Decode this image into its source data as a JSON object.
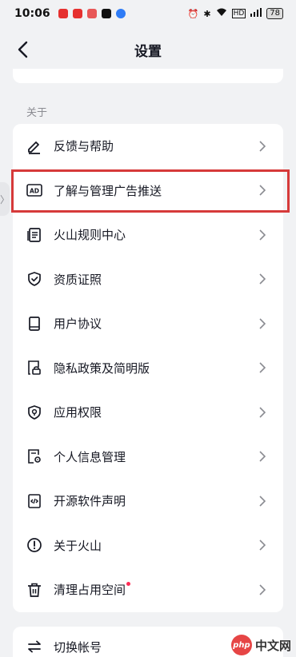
{
  "status": {
    "time": "10:06",
    "battery": "78",
    "app_icon_colors": [
      "#e6302f",
      "#e6302f",
      "#111111",
      "#111111",
      "#2f7cf6"
    ]
  },
  "header": {
    "title": "设置"
  },
  "about_section": {
    "label": "关于",
    "items": [
      {
        "label": "反馈与帮助",
        "icon": "pencil-icon"
      },
      {
        "label": "了解与管理广告推送",
        "icon": "ad-icon"
      },
      {
        "label": "火山规则中心",
        "icon": "rules-doc-icon"
      },
      {
        "label": "资质证照",
        "icon": "shield-check-icon"
      },
      {
        "label": "用户协议",
        "icon": "book-icon"
      },
      {
        "label": "隐私政策及简明版",
        "icon": "lock-doc-icon"
      },
      {
        "label": "应用权限",
        "icon": "shield-pin-icon"
      },
      {
        "label": "个人信息管理",
        "icon": "doc-gear-icon"
      },
      {
        "label": "开源软件声明",
        "icon": "code-doc-icon"
      },
      {
        "label": "关于火山",
        "icon": "info-circle-icon"
      },
      {
        "label": "清理占用空间",
        "icon": "trash-icon",
        "badge": true
      }
    ]
  },
  "account_section": {
    "items": [
      {
        "label": "切换帐号",
        "icon": "switch-icon"
      }
    ]
  },
  "watermark": {
    "logo_text": "php",
    "text": "中文网"
  },
  "colors": {
    "highlight": "#d63a3a",
    "badge": "#fe2c55",
    "background": "#f1f2f4"
  }
}
